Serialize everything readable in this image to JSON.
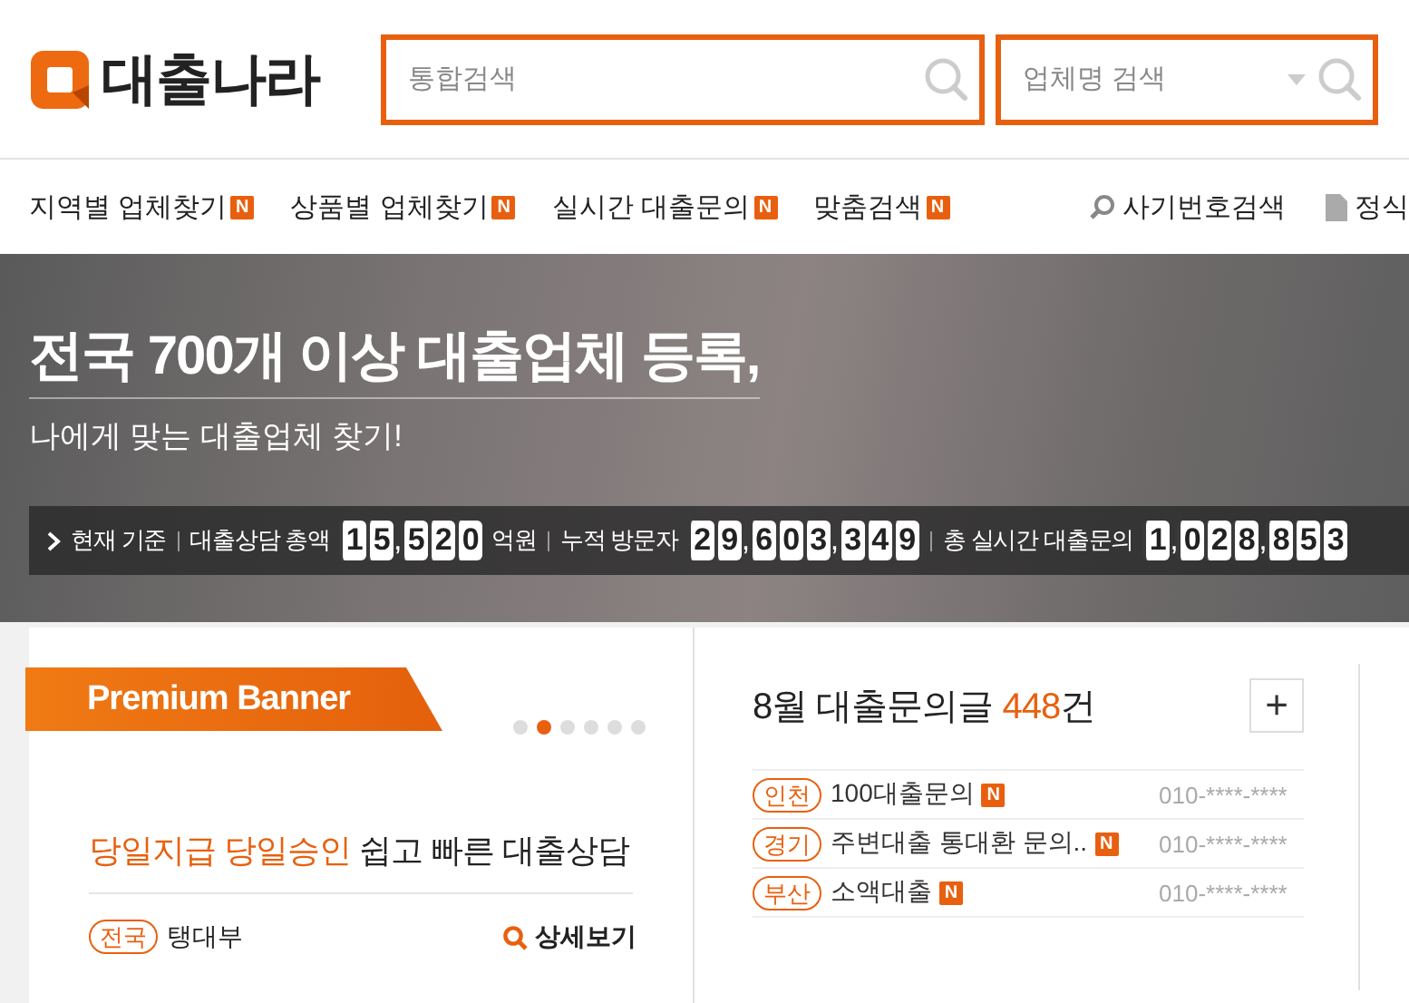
{
  "header": {
    "logo": "대출나라",
    "search": {
      "placeholder": "통합검색"
    },
    "company_search": {
      "placeholder": "업체명 검색"
    }
  },
  "nav": {
    "items": [
      {
        "label": "지역별 업체찾기",
        "badge": "N"
      },
      {
        "label": "상품별 업체찾기",
        "badge": "N"
      },
      {
        "label": "실시간 대출문의",
        "badge": "N"
      },
      {
        "label": "맞춤검색",
        "badge": "N"
      }
    ],
    "right": [
      {
        "kind": "search",
        "label": "사기번호검색"
      },
      {
        "kind": "doc",
        "label": "정식"
      }
    ]
  },
  "hero": {
    "headline": "전국 **700개 이상** 대출업체 등록,",
    "subline": "나에게 맞는 대출업체 찾기!",
    "stats": {
      "basis": "현재 기준",
      "items": [
        {
          "label": "대출상담 총액",
          "digits": [
            "1",
            "5",
            ",",
            "5",
            "2",
            "0"
          ],
          "unit": "억원"
        },
        {
          "label": "누적 방문자",
          "digits": [
            "2",
            "9",
            ",",
            "6",
            "0",
            "3",
            ",",
            "3",
            "4",
            "9"
          ]
        },
        {
          "label": "총 실시간 대출문의",
          "digits": [
            "1",
            ",",
            "0",
            "2",
            "8",
            ",",
            "8",
            "5",
            "3"
          ]
        }
      ]
    }
  },
  "premium": {
    "tag": "Premium Banner",
    "dots": [
      {
        "selected": false
      },
      {
        "selected": true
      },
      {
        "selected": false
      },
      {
        "selected": false
      },
      {
        "selected": false
      },
      {
        "selected": false
      }
    ],
    "highlight": "당일지급 당일승인",
    "text": "쉽고 빠른 대출상담",
    "region": "전국",
    "company": "탱대부",
    "detail": "상세보기"
  },
  "inquiries": {
    "title": "8월 대출문의글 ",
    "count": "448",
    "suffix": "건",
    "more": "+",
    "rows": [
      {
        "region": "인천",
        "title": "100대출문의",
        "badge": "N",
        "phone": "010-****-****"
      },
      {
        "region": "경기",
        "title": "주변대출 통대환 문의..",
        "badge": "N",
        "phone": "010-****-****"
      },
      {
        "region": "부산",
        "title": "소액대출",
        "badge": "N",
        "phone": "010-****-****"
      }
    ]
  }
}
